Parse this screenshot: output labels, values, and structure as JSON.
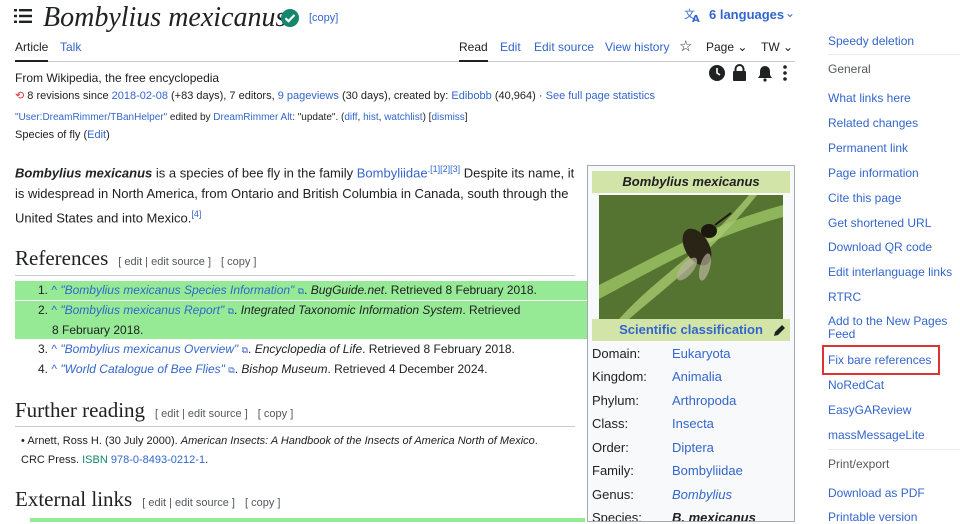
{
  "title": "Bombylius mexicanus",
  "copy_label": "[copy]",
  "languages_label": "6 languages",
  "tabs": {
    "article": "Article",
    "talk": "Talk",
    "read": "Read",
    "edit": "Edit",
    "edit_source": "Edit source",
    "view_history": "View history",
    "page": "Page",
    "tw": "TW"
  },
  "tagline": "From Wikipedia, the free encyclopedia",
  "stats": {
    "revisions": "8 revisions since",
    "date": "2018-02-08",
    "after_date": "(+83 days), 7 editors,",
    "pageviews": "9 pageviews",
    "after_pv": "(30 days), created by:",
    "creator": "Edibobb",
    "creator_count": "(40,964)",
    "sep": "·",
    "full_stats": "See full page statistics"
  },
  "edit_notice": {
    "user": "\"User:DreamRimmer/TBanHelper\"",
    "edited_by": "edited by",
    "editor": "DreamRimmer Alt",
    "summary": ": \"update\". (",
    "diff": "diff",
    "hist": "hist",
    "watchlist": "watchlist",
    "close": ") [",
    "dismiss": "dismiss",
    "end": "]"
  },
  "short_desc": {
    "text": "Species of fly (",
    "edit": "Edit",
    "end": ")"
  },
  "lead": {
    "bold": "Bombylius mexicanus",
    "t1": " is a species of bee fly in the family ",
    "family": "Bombyliidae",
    "cites1": ".[1][2][3]",
    "t2": " Despite its name, it is widespread in North America, from Ontario and British Columbia in Canada, south through the United States and into Mexico.",
    "cite4": "[4]"
  },
  "sections": {
    "references": "References",
    "further": "Further reading",
    "external": "External links",
    "edit": "[ edit | edit source ]",
    "copy": "[ copy ]"
  },
  "refs": [
    {
      "n": "1.",
      "caret": "^",
      "link": "\"Bombylius mexicanus Species Information\"",
      "pub": "BugGuide.net",
      "rest": ". Retrieved 8 February 2018.",
      "rest2": ""
    },
    {
      "n": "2.",
      "caret": "^",
      "link": "\"Bombylius mexicanus Report\"",
      "pub": "Integrated Taxonomic Information System",
      "rest": ". Retrieved",
      "rest2": "8 February 2018."
    },
    {
      "n": "3.",
      "caret": "^",
      "link": "\"Bombylius mexicanus Overview\"",
      "pub": "Encyclopedia of Life",
      "rest": ". Retrieved 8 February 2018.",
      "rest2": ""
    },
    {
      "n": "4.",
      "caret": "^",
      "link": "\"World Catalogue of Bee Flies\"",
      "pub": "Bishop Museum",
      "rest": ". Retrieved 4 December 2024.",
      "rest2": ""
    }
  ],
  "further": {
    "author": "Arnett, Ross H. (30 July 2000). ",
    "book": "American Insects: A Handbook of the Insects of America North of Mexico",
    "pub": ". CRC Press. ",
    "isbn_label": "ISBN",
    "isbn": "978-0-8493-0212-1",
    "end": "."
  },
  "infobox": {
    "title": "Bombylius mexicanus",
    "classification": "Scientific classification",
    "rows": [
      {
        "k": "Domain:",
        "v": "Eukaryota"
      },
      {
        "k": "Kingdom:",
        "v": "Animalia"
      },
      {
        "k": "Phylum:",
        "v": "Arthropoda"
      },
      {
        "k": "Class:",
        "v": "Insecta"
      },
      {
        "k": "Order:",
        "v": "Diptera"
      },
      {
        "k": "Family:",
        "v": "Bombyliidae"
      },
      {
        "k": "Genus:",
        "v": "Bombylius"
      },
      {
        "k": "Species:",
        "v": "B. mexicanus"
      }
    ]
  },
  "sidebar": {
    "speedy": "Speedy deletion",
    "general": "General",
    "items": [
      "What links here",
      "Related changes",
      "Permanent link",
      "Page information",
      "Cite this page",
      "Get shortened URL",
      "Download QR code",
      "Edit interlanguage links",
      "RTRC"
    ],
    "add_new_pages_1": "Add to the New Pages",
    "add_new_pages_2": "Feed",
    "fix_bare": "Fix bare references",
    "items2": [
      "NoRedCat",
      "EasyGAReview",
      "massMessageLite"
    ],
    "print_export": "Print/export",
    "download_pdf": "Download as PDF",
    "printable": "Printable version"
  },
  "colors": {
    "link": "#3366cc",
    "highlight": "#96ea96",
    "infobox_header": "#d3e4a8",
    "red_box": "#d33",
    "green_check": "#14866d"
  }
}
